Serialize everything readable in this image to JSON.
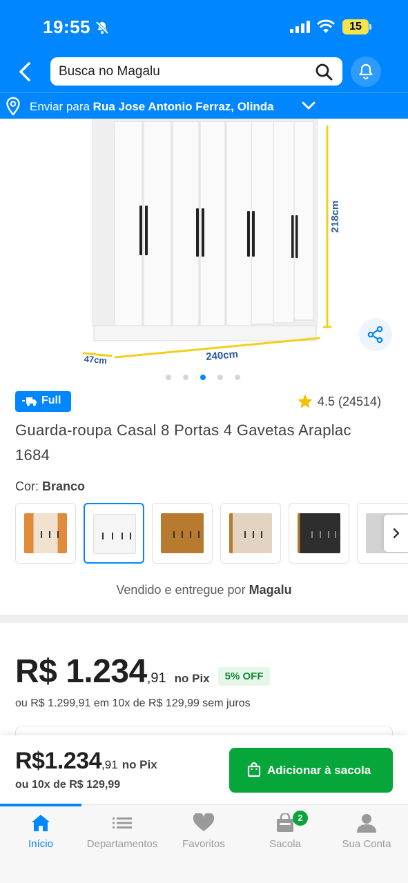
{
  "status_bar": {
    "time": "19:55",
    "battery": "15"
  },
  "header": {
    "search_placeholder": "Busca no Magalu"
  },
  "address": {
    "prefix": "Enviar para",
    "street": "Rua Jose Antonio Ferraz, Olinda"
  },
  "product": {
    "image_labels": {
      "height": "218cm",
      "width": "240cm",
      "depth": "47cm"
    },
    "carousel": {
      "count": 5,
      "active_index": 2
    },
    "badge": "Full",
    "rating": "4.5 (24514)",
    "title": "Guarda-roupa Casal 8 Portas 4 Gavetas Araplac 1684",
    "color_label": "Cor:",
    "color_value": "Branco",
    "swatches": [
      {
        "name": "laranja",
        "color": "#e08a3c",
        "selected": false
      },
      {
        "name": "branco",
        "color": "#f4f4f4",
        "selected": true
      },
      {
        "name": "amadeirado",
        "color": "#b77a2e",
        "selected": false
      },
      {
        "name": "bege",
        "color": "#d9c6ae",
        "selected": false
      },
      {
        "name": "preto",
        "color": "#2e2e2e",
        "selected": false
      },
      {
        "name": "cinza",
        "color": "#cfcfcf",
        "selected": false
      }
    ],
    "seller_prefix": "Vendido e entregue por",
    "seller_name": "Magalu"
  },
  "pricing": {
    "main": "R$ 1.234",
    "cents": ",91",
    "pix": "no Pix",
    "discount": "5% OFF",
    "installment": "ou R$ 1.299,91 em 10x de R$ 129,99 sem juros"
  },
  "sticky": {
    "price": "R$1.234",
    "cents": ",91",
    "pix": "no Pix",
    "installment": "ou 10x de R$ 129,99",
    "button": "Adicionar à sacola"
  },
  "tabbar": {
    "tabs": [
      "Início",
      "Departamentos",
      "Favoritos",
      "Sacola",
      "Sua Conta"
    ],
    "cart_count": "2"
  },
  "colors": {
    "brand_blue": "#0086ff",
    "green": "#07a63a"
  }
}
